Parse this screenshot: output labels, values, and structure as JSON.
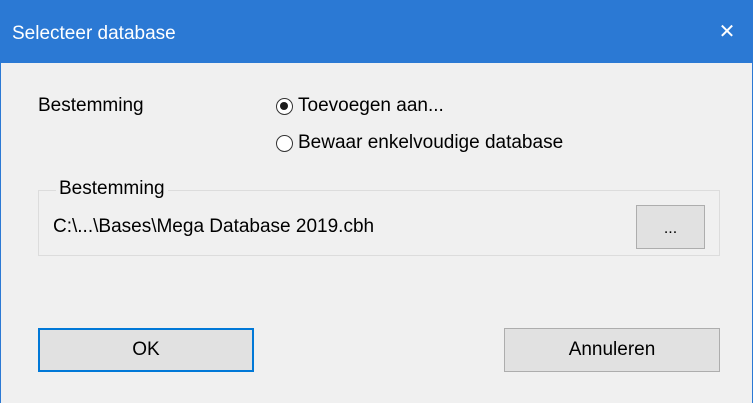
{
  "window": {
    "title": "Selecteer database",
    "close_glyph": "✕",
    "accent_color": "#2b79d4"
  },
  "destination": {
    "label": "Bestemming",
    "options": [
      {
        "label": "Toevoegen aan...",
        "selected": true
      },
      {
        "label": "Bewaar enkelvoudige database",
        "selected": false
      }
    ]
  },
  "target_group": {
    "label": "Bestemming",
    "path": "C:\\...\\Bases\\Mega Database 2019.cbh",
    "browse_label": "..."
  },
  "buttons": {
    "ok": "OK",
    "cancel": "Annuleren"
  },
  "icons": {
    "close": "close-icon"
  }
}
